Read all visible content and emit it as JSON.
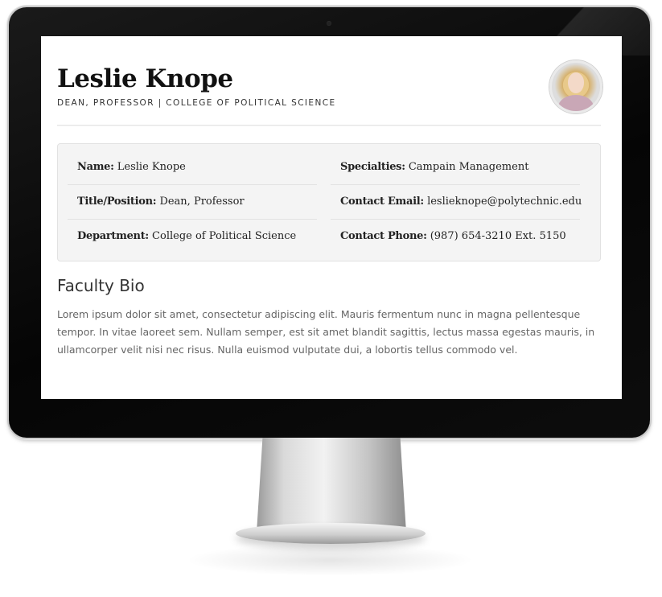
{
  "profile": {
    "name": "Leslie Knope",
    "title": "DEAN, PROFESSOR | COLLEGE OF POLITICAL SCIENCE"
  },
  "info": {
    "left": [
      {
        "label": "Name:",
        "value": "Leslie Knope"
      },
      {
        "label": "Title/Position:",
        "value": "Dean, Professor"
      },
      {
        "label": "Department:",
        "value": "College of Political Science"
      }
    ],
    "right": [
      {
        "label": "Specialties:",
        "value": "Campain Management"
      },
      {
        "label": "Contact Email:",
        "value": "leslieknope@polytechnic.edu"
      },
      {
        "label": "Contact Phone:",
        "value": "(987) 654-3210 Ext. 5150"
      }
    ]
  },
  "bio": {
    "heading": "Faculty Bio",
    "text": "Lorem ipsum dolor sit amet, consectetur adipiscing elit. Mauris fermentum nunc in magna pellentesque tempor. In vitae laoreet sem. Nullam semper, est sit amet blandit sagittis, lectus massa egestas mauris, in ullamcorper velit nisi nec risus. Nulla euismod vulputate dui, a lobortis tellus commodo vel."
  }
}
